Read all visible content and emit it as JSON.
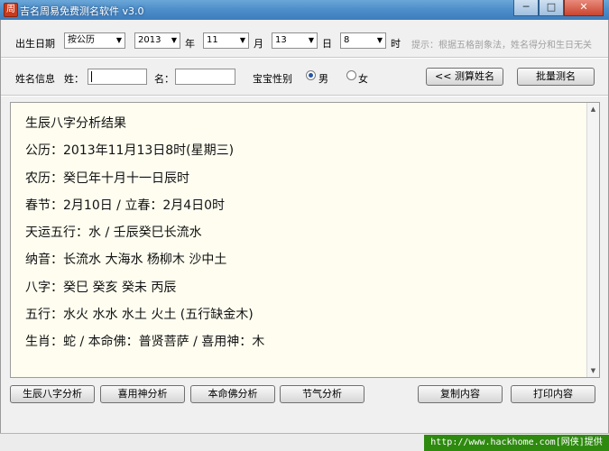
{
  "window": {
    "title": "吉名周易免费测名软件 v3.0",
    "app_icon_glyph": "周",
    "minimize": "─",
    "maximize": "□",
    "close": "✕"
  },
  "birth": {
    "label": "出生日期",
    "calendar": "按公历",
    "year": "2013",
    "year_unit": "年",
    "month": "11",
    "month_unit": "月",
    "day": "13",
    "day_unit": "日",
    "hour": "8",
    "hour_unit": "时",
    "hint": "提示：根据五格剖象法，姓名得分和生日无关"
  },
  "name": {
    "label": "姓名信息",
    "surname_label": "姓：",
    "surname_value": "",
    "given_label": "名：",
    "given_value": "",
    "gender_label": "宝宝性别",
    "male": "男",
    "female": "女",
    "male_selected": true,
    "calc_button": "<< 测算姓名",
    "batch_button": "批量测名"
  },
  "result": {
    "lines": [
      "生辰八字分析结果",
      "公历：2013年11月13日8时(星期三)",
      "农历：癸巳年十月十一日辰时",
      "春节：2月10日 / 立春：2月4日0时",
      "天运五行：水 / 壬辰癸巳长流水",
      "纳音：长流水 大海水 杨柳木 沙中土",
      "八字：癸巳 癸亥 癸未 丙辰",
      "五行：水火 水水 水土 火土 (五行缺金木)",
      "生肖：蛇 / 本命佛：普贤菩萨 / 喜用神：木"
    ]
  },
  "buttons": {
    "bazi": "生辰八字分析",
    "xiyongshen": "喜用神分析",
    "benmingfo": "本命佛分析",
    "jieqi": "节气分析",
    "copy": "复制内容",
    "print": "打印内容"
  },
  "footer": {
    "text": "http://www.hackhome.com[网侠]提供"
  },
  "colors": {
    "titlebar": "#4f8fca",
    "panel_bg": "#fefdf0",
    "footer_bg": "#2e8a0f",
    "hint": "#a0a0a0"
  }
}
